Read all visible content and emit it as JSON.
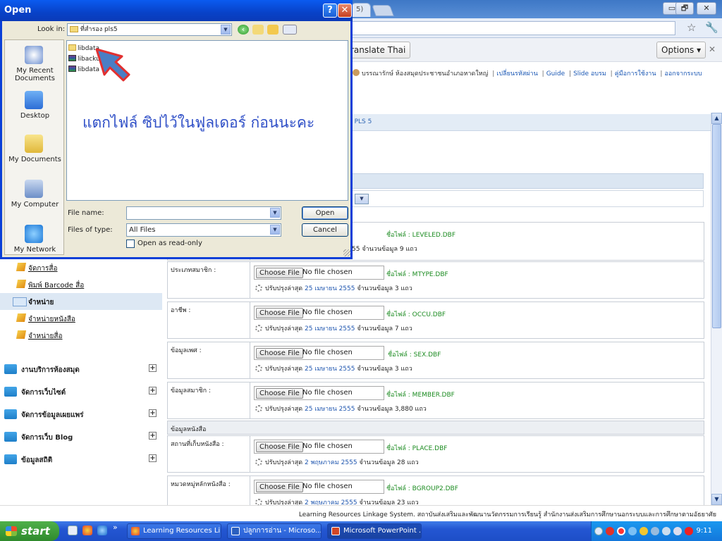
{
  "browser": {
    "tab_title_partial": "5) ×",
    "window_min": "▭",
    "window_max": "🗗",
    "window_close": "✕",
    "star_icon": "☆",
    "wrench_icon": "🔧",
    "translate_label": "ranslate Thai",
    "options_label": "Options ▾",
    "close_bar": "✕"
  },
  "page": {
    "userbar": {
      "user": "บรรณารักษ์ ห้องสมุดประชาชนอำเภอหาดใหญ่",
      "links": [
        "เปลี่ยนรหัสผ่าน",
        "Guide",
        "Slide อบรม",
        "คู่มือการใช้งาน",
        "ออกจากระบบ"
      ]
    },
    "breadcrumb": "n PLS 5",
    "select_value": "",
    "first_row_update": "55 จำนวนข้อมูล 9 แถว",
    "first_row_file": "ชื่อไฟล์ : LEVELED.DBF",
    "sidebar": {
      "sub_items": [
        {
          "label": "จัดการสื่อ",
          "active": false
        },
        {
          "label": "พิมพ์ Barcode สื่อ",
          "active": false
        },
        {
          "label": "จำหน่าย",
          "active": true
        },
        {
          "label": "จำหน่ายหนังสือ",
          "active": false
        },
        {
          "label": "จำหน่ายสื่อ",
          "active": false
        }
      ],
      "main_sections": [
        {
          "label": "งานบริการห้องสมุด"
        },
        {
          "label": "จัดการเว็บไซต์"
        },
        {
          "label": "จัดการข้อมูลเผยแพร่"
        },
        {
          "label": "จัดการเว็บ Blog"
        },
        {
          "label": "ข้อมูลสถิติ"
        }
      ],
      "plus": "+"
    },
    "choose_file": "Choose File",
    "no_file": "No file chosen",
    "update_prefix": "ปรับปรุงล่าสุด",
    "rows": [
      {
        "label": "ประเภทสมาชิก :",
        "file": "ชื่อไฟล์ : MTYPE.DBF",
        "date": "25 เมษายน 2555",
        "count": "จำนวนข้อมูล 3 แถว"
      },
      {
        "label": "อาชีพ :",
        "file": "ชื่อไฟล์ : OCCU.DBF",
        "date": "25 เมษายน 2555",
        "count": "จำนวนข้อมูล 7 แถว"
      },
      {
        "label": "ข้อมูลเพศ :",
        "file": "ชื่อไฟล์ : SEX.DBF",
        "date": "25 เมษายน 2555",
        "count": "จำนวนข้อมูล 3 แถว"
      },
      {
        "label": "ข้อมูลสมาชิก :",
        "file": "ชื่อไฟล์ : MEMBER.DBF",
        "date": "25 เมษายน 2555",
        "count": "จำนวนข้อมูล 3,880 แถว"
      },
      {
        "label": "สถานที่เก็บหนังสือ :",
        "file": "ชื่อไฟล์ : PLACE.DBF",
        "date": "2 พฤษภาคม 2555",
        "count": "จำนวนข้อมูล 28 แถว"
      },
      {
        "label": "หมวดหมู่หลักหนังสือ :",
        "file": "ชื่อไฟล์ : BGROUP2.DBF",
        "date": "2 พฤษภาคม 2555",
        "count": "จำนวนข้อมูล 23 แถว"
      }
    ],
    "book_section": "ข้อมูลหนังสือ",
    "footer": "Learning Resources Linkage System. สถาบันส่งเสริมและพัฒนานวัตกรรมการเรียนรู้ สำนักงานส่งเสริมการศึกษานอกระบบและการศึกษาตามอัธยาศัย"
  },
  "dialog": {
    "title": "Open",
    "help": "?",
    "close": "✕",
    "look_in_label": "Look in:",
    "look_in_value": "ที่สำรอง pls5",
    "places": [
      "My Recent Documents",
      "Desktop",
      "My Documents",
      "My Computer",
      "My Network"
    ],
    "files": [
      {
        "name": "libdata",
        "type": "folder"
      },
      {
        "name": "libackup",
        "type": "rar"
      },
      {
        "name": "libdata",
        "type": "rar"
      }
    ],
    "annotation": "แตกไฟล์ ซิปไว้ในฟูลเดอร์ ก่อนนะคะ",
    "file_name_label": "File name:",
    "file_name_value": "",
    "file_type_label": "Files of type:",
    "file_type_value": "All Files",
    "readonly_label": "Open as read-only",
    "open_label": "Open",
    "cancel_label": "Cancel",
    "dropdown": "▼"
  },
  "taskbar": {
    "start": "start",
    "more": "»",
    "tasks": [
      "Learning Resources Li...",
      "ปลูกการอ่าน - Microso...",
      "Microsoft PowerPoint ..."
    ],
    "clock": "9:11"
  }
}
